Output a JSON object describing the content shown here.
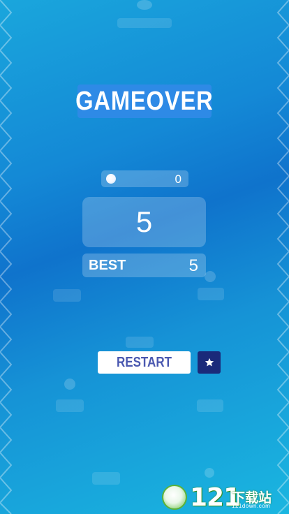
{
  "game": {
    "title": "GAMEOVER",
    "coins": "0",
    "score": "5",
    "best_label": "BEST",
    "best_value": "5"
  },
  "buttons": {
    "restart_label": "RESTART",
    "star_icon": "star-icon"
  },
  "watermark": {
    "number": "121",
    "text": "下载站",
    "url": "121down.com"
  },
  "colors": {
    "title_bg": "#2e8ae6",
    "restart_text": "#4a58b0",
    "star_button_bg": "#1a2a7a",
    "watermark_green": "#5bb23a"
  }
}
